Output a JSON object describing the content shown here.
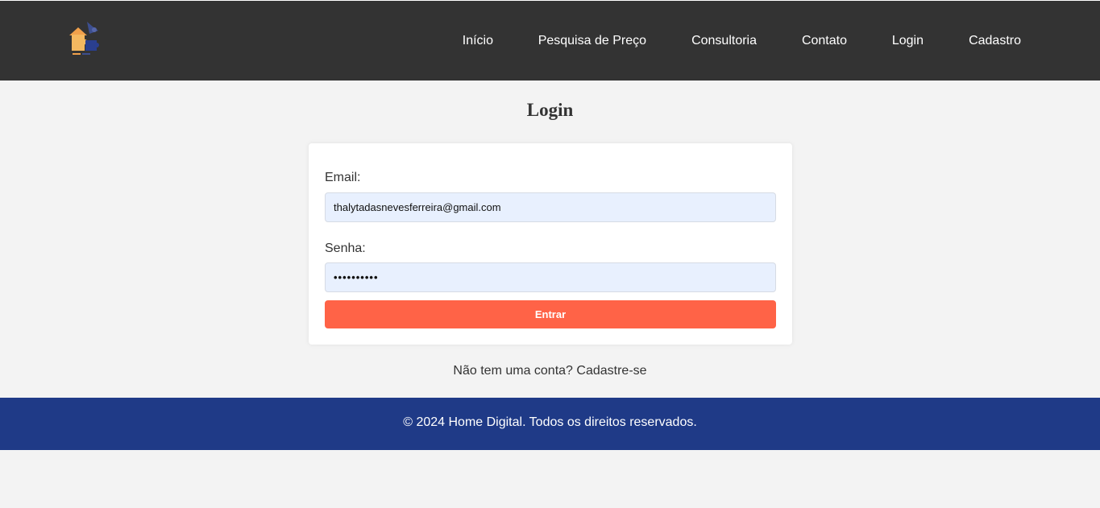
{
  "header": {
    "logo_icon": "home-puzzle-logo",
    "nav": [
      {
        "label": "Início"
      },
      {
        "label": "Pesquisa de Preço"
      },
      {
        "label": "Consultoria"
      },
      {
        "label": "Contato"
      },
      {
        "label": "Login"
      },
      {
        "label": "Cadastro"
      }
    ]
  },
  "main": {
    "title": "Login",
    "form": {
      "email_label": "Email:",
      "email_value": "thalytadasnevesferreira@gmail.com",
      "password_label": "Senha:",
      "password_value": "••••••••••",
      "submit_label": "Entrar"
    },
    "signup": {
      "prompt": "Não tem uma conta?",
      "link_label": "Cadastre-se"
    }
  },
  "footer": {
    "text": "© 2024 Home Digital. Todos os direitos reservados."
  },
  "colors": {
    "header_bg": "#333333",
    "page_bg": "#f3f3f3",
    "button_bg": "#ff6347",
    "input_bg": "#e8f0fe",
    "footer_bg": "#1f3a87"
  }
}
